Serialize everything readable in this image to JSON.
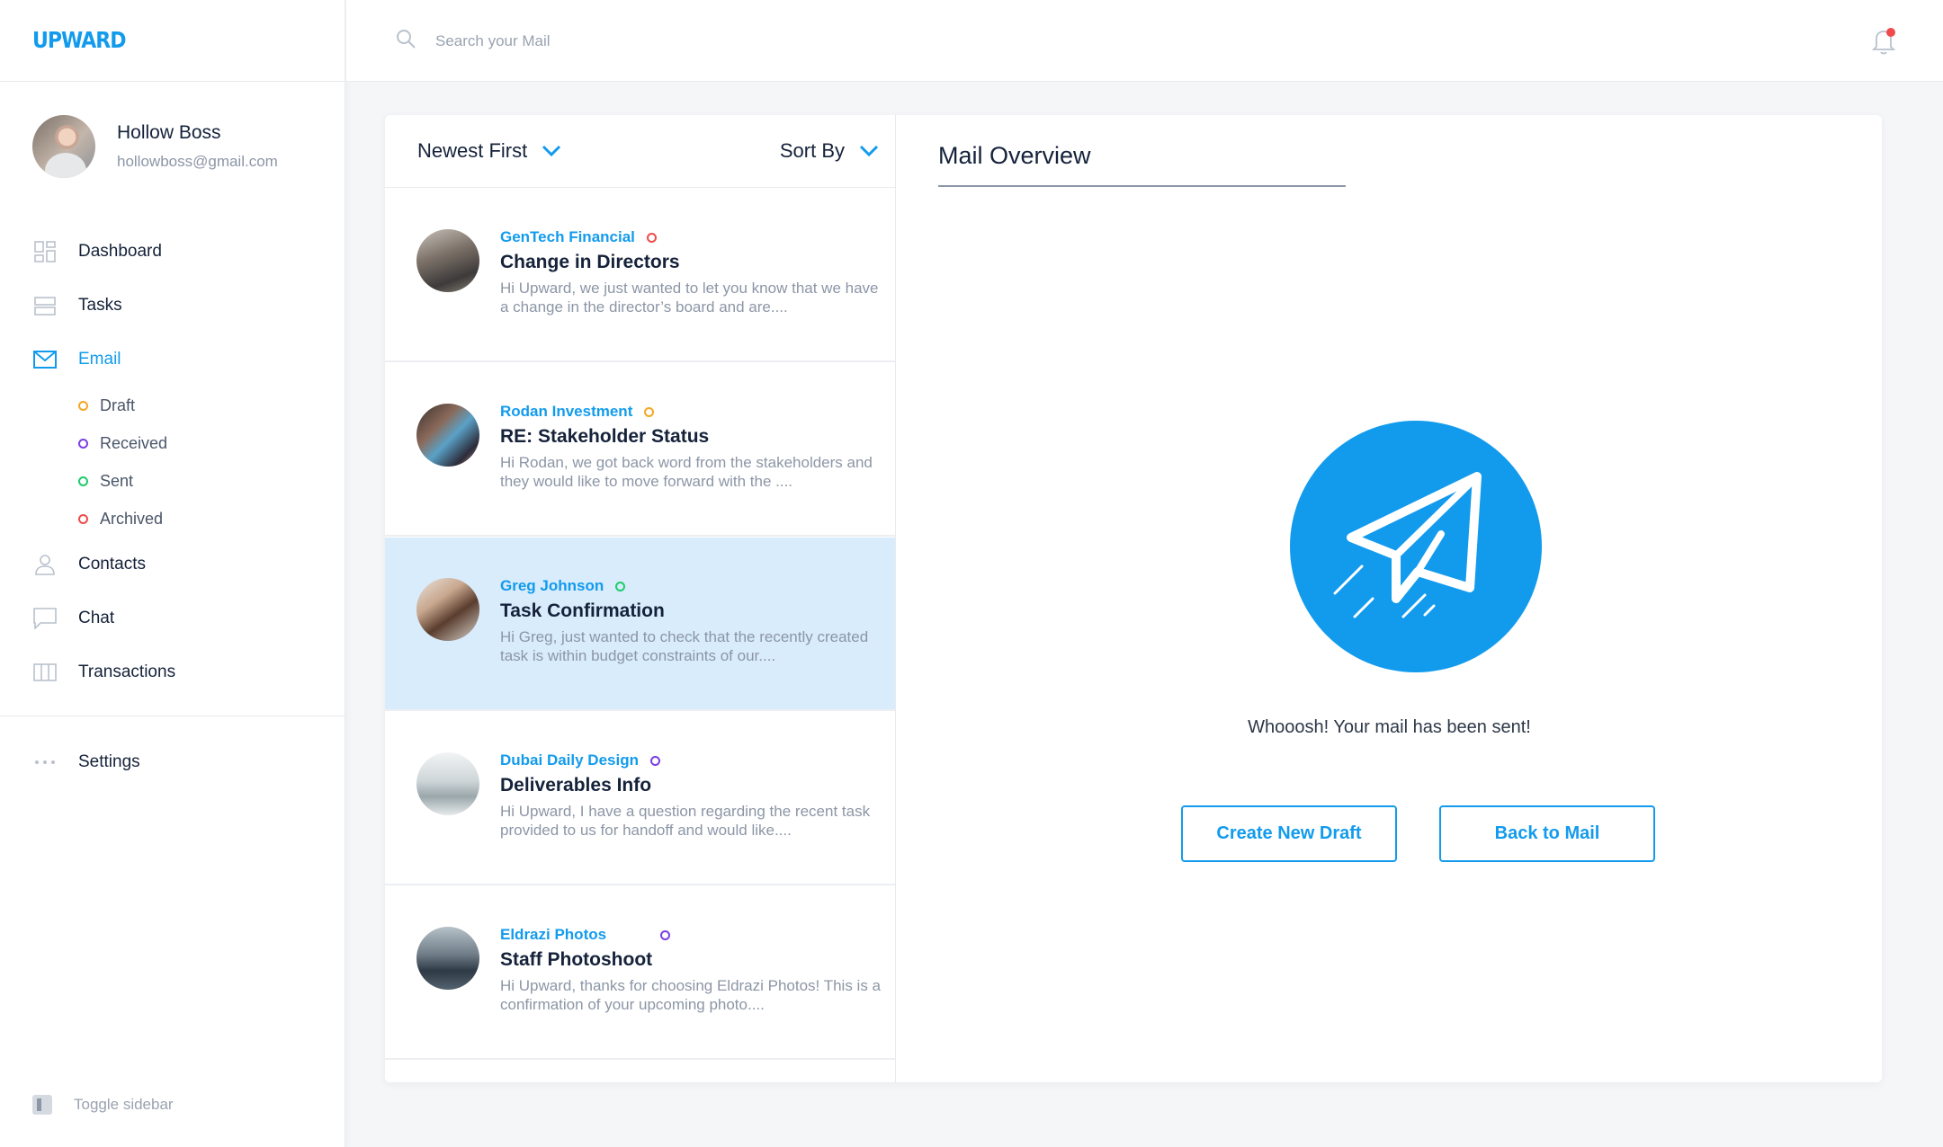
{
  "app": {
    "logo": "UPWARD",
    "accent": "#129bed"
  },
  "user": {
    "name": "Hollow Boss",
    "email": "hollowboss@gmail.com"
  },
  "nav": {
    "items": [
      {
        "label": "Dashboard",
        "icon": "dashboard-icon"
      },
      {
        "label": "Tasks",
        "icon": "tasks-icon"
      },
      {
        "label": "Email",
        "icon": "mail-icon",
        "active": true
      }
    ],
    "email_sub": [
      {
        "label": "Draft",
        "color": "#f5a623"
      },
      {
        "label": "Received",
        "color": "#7b3fe4"
      },
      {
        "label": "Sent",
        "color": "#1fcb6b"
      },
      {
        "label": "Archived",
        "color": "#ef4b4b"
      }
    ],
    "more": [
      {
        "label": "Contacts",
        "icon": "user-icon"
      },
      {
        "label": "Chat",
        "icon": "chat-icon"
      },
      {
        "label": "Transactions",
        "icon": "columns-icon"
      }
    ],
    "settings": "Settings",
    "toggle": "Toggle sidebar"
  },
  "search": {
    "placeholder": "Search your Mail"
  },
  "list": {
    "sort_order": "Newest First",
    "sort_by": "Sort By",
    "mails": [
      {
        "sender": "GenTech Financial",
        "subject": "Change in Directors",
        "preview": "Hi Upward, we just wanted to let you know that we have a change in the director’s board and are....",
        "dot": "#ef4b4b"
      },
      {
        "sender": "Rodan Investment",
        "subject": "RE: Stakeholder Status",
        "preview": "Hi Rodan, we got back word from the stakeholders and they would like to move forward with the ....",
        "dot": "#f5a623"
      },
      {
        "sender": "Greg Johnson",
        "subject": "Task Confirmation",
        "preview": "Hi Greg, just wanted to check that the recently created task is within budget constraints of our....",
        "dot": "#1fcb6b",
        "selected": true
      },
      {
        "sender": "Dubai Daily Design",
        "subject": "Deliverables Info",
        "preview": "Hi Upward, I have a question regarding the recent task provided to us for handoff and would like....",
        "dot": "#7b3fe4"
      },
      {
        "sender": "Eldrazi Photos",
        "subject": "Staff Photoshoot",
        "preview": "Hi Upward, thanks for choosing Eldrazi Photos! This is a confirmation of your upcoming photo....",
        "dot": "#7b3fe4"
      }
    ]
  },
  "overview": {
    "title": "Mail Overview",
    "message": "Whooosh! Your mail has been sent!",
    "create_label": "Create New Draft",
    "back_label": "Back to Mail"
  }
}
